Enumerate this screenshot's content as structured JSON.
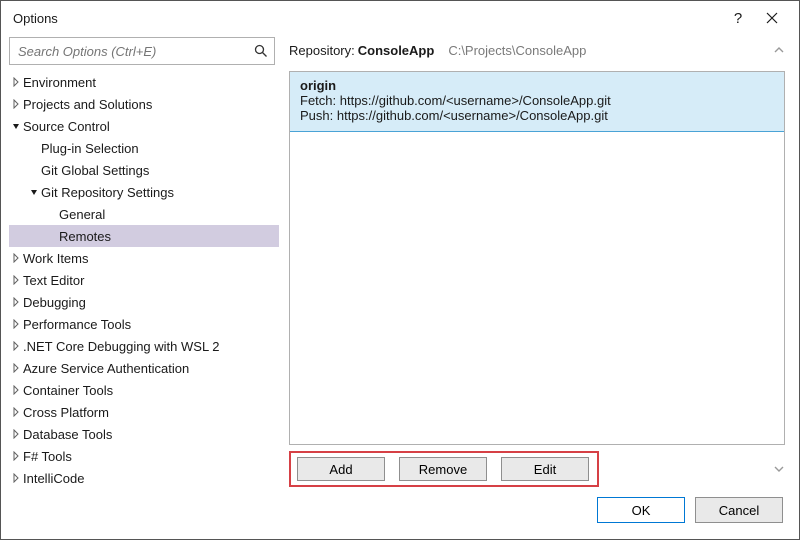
{
  "window": {
    "title": "Options"
  },
  "search": {
    "placeholder": "Search Options (Ctrl+E)"
  },
  "tree": {
    "nodes": [
      {
        "label": "Environment",
        "depth": 0,
        "arrow": "right"
      },
      {
        "label": "Projects and Solutions",
        "depth": 0,
        "arrow": "right"
      },
      {
        "label": "Source Control",
        "depth": 0,
        "arrow": "down"
      },
      {
        "label": "Plug-in Selection",
        "depth": 1,
        "arrow": "none"
      },
      {
        "label": "Git Global Settings",
        "depth": 1,
        "arrow": "none"
      },
      {
        "label": "Git Repository Settings",
        "depth": 1,
        "arrow": "down"
      },
      {
        "label": "General",
        "depth": 2,
        "arrow": "none"
      },
      {
        "label": "Remotes",
        "depth": 2,
        "arrow": "none",
        "selected": true
      },
      {
        "label": "Work Items",
        "depth": 0,
        "arrow": "right"
      },
      {
        "label": "Text Editor",
        "depth": 0,
        "arrow": "right"
      },
      {
        "label": "Debugging",
        "depth": 0,
        "arrow": "right"
      },
      {
        "label": "Performance Tools",
        "depth": 0,
        "arrow": "right"
      },
      {
        "label": ".NET Core Debugging with WSL 2",
        "depth": 0,
        "arrow": "right"
      },
      {
        "label": "Azure Service Authentication",
        "depth": 0,
        "arrow": "right"
      },
      {
        "label": "Container Tools",
        "depth": 0,
        "arrow": "right"
      },
      {
        "label": "Cross Platform",
        "depth": 0,
        "arrow": "right"
      },
      {
        "label": "Database Tools",
        "depth": 0,
        "arrow": "right"
      },
      {
        "label": "F# Tools",
        "depth": 0,
        "arrow": "right"
      },
      {
        "label": "IntelliCode",
        "depth": 0,
        "arrow": "right"
      }
    ]
  },
  "repo": {
    "label_prefix": "Repository: ",
    "name": "ConsoleApp",
    "path": "C:\\Projects\\ConsoleApp"
  },
  "remotes": [
    {
      "name": "origin",
      "fetch": "Fetch: https://github.com/<username>/ConsoleApp.git",
      "push": "Push: https://github.com/<username>/ConsoleApp.git"
    }
  ],
  "buttons": {
    "add": "Add",
    "remove": "Remove",
    "edit": "Edit",
    "ok": "OK",
    "cancel": "Cancel"
  }
}
